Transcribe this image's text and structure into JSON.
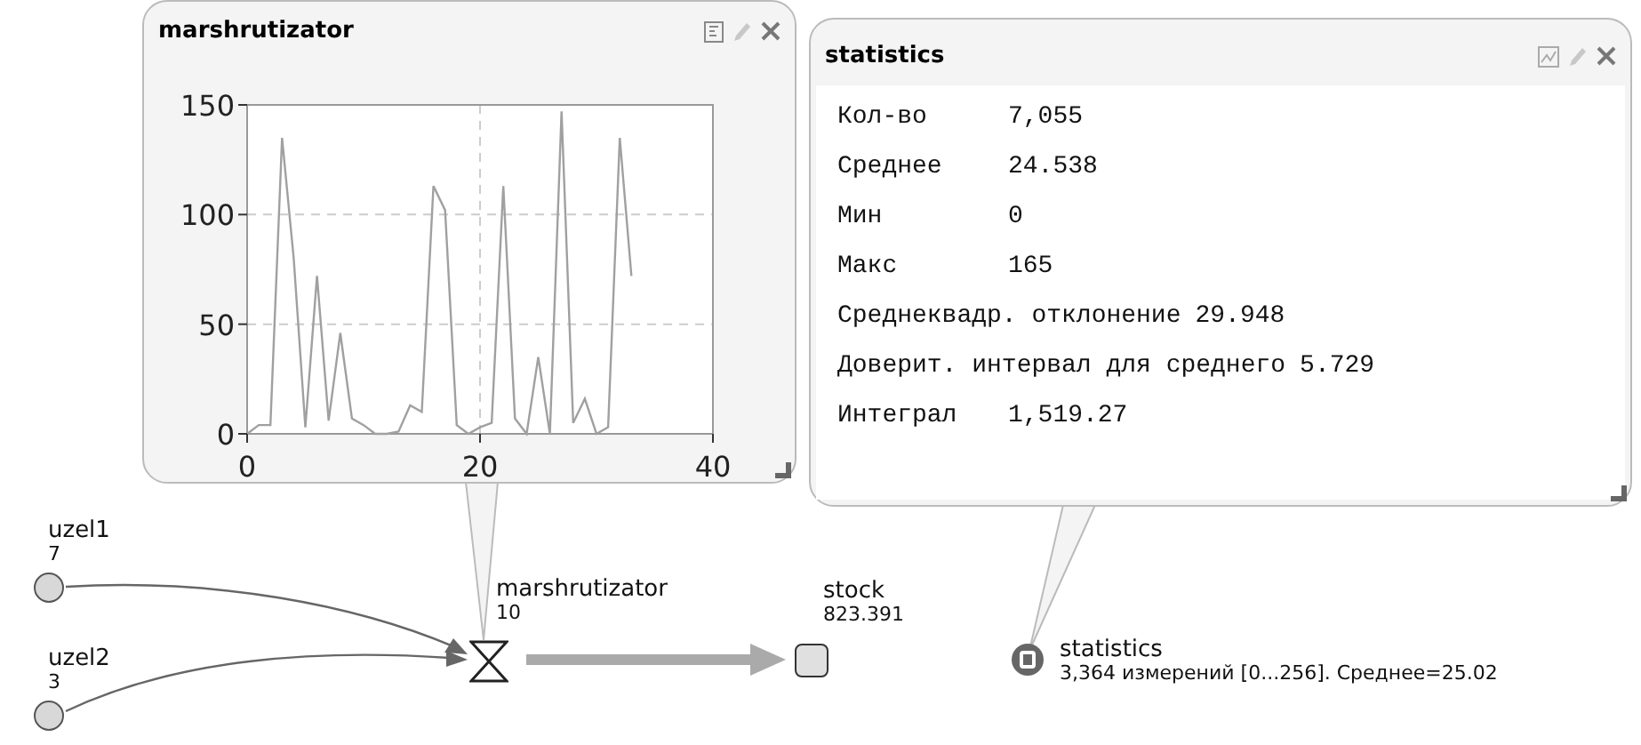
{
  "chart_window": {
    "title": "marshrutizator",
    "chart_data": {
      "type": "line",
      "x": [
        0,
        1,
        2,
        3,
        4,
        5,
        6,
        7,
        8,
        9,
        10,
        11,
        12,
        13,
        14,
        15,
        16,
        17,
        18,
        19,
        20,
        21,
        22,
        23,
        24,
        25,
        26,
        27,
        28,
        29,
        30,
        31,
        32,
        33
      ],
      "series": [
        {
          "color": "#a0a0a0",
          "values": [
            0,
            4,
            4,
            135,
            80,
            3,
            72,
            6,
            46,
            7,
            4,
            0,
            0,
            1,
            13,
            10,
            113,
            102,
            4,
            0,
            3,
            5,
            113,
            7,
            0,
            35,
            0,
            147,
            5,
            16,
            0,
            3,
            135,
            72
          ]
        }
      ],
      "xlim": [
        0,
        40
      ],
      "ylim": [
        0,
        150
      ],
      "xticks": [
        0,
        20,
        40
      ],
      "yticks": [
        0,
        50,
        100,
        150
      ],
      "grid": true
    }
  },
  "statistics_window": {
    "title": "statistics",
    "rows": [
      {
        "label": "Кол-во",
        "value": "7,055"
      },
      {
        "label": "Среднее",
        "value": "24.538"
      },
      {
        "label": "Мин",
        "value": "0"
      },
      {
        "label": "Макс",
        "value": "165"
      },
      {
        "label": "Среднеквадр. отклонение",
        "value": "29.948"
      },
      {
        "label": "Доверит. интервал для среднего",
        "value": "5.729"
      },
      {
        "label": "Интеграл",
        "value": "1,519.27"
      }
    ]
  },
  "nodes": [
    {
      "kind": "source",
      "name": "uzel1",
      "value": "7"
    },
    {
      "kind": "source",
      "name": "uzel2",
      "value": "3"
    },
    {
      "kind": "delay",
      "name": "marshrutizator",
      "value": "10"
    },
    {
      "kind": "stock",
      "name": "stock",
      "value": "823.391"
    },
    {
      "kind": "statistics",
      "name": "statistics",
      "value": "3,364 измерений [0...256]. Среднее=25.02"
    }
  ]
}
